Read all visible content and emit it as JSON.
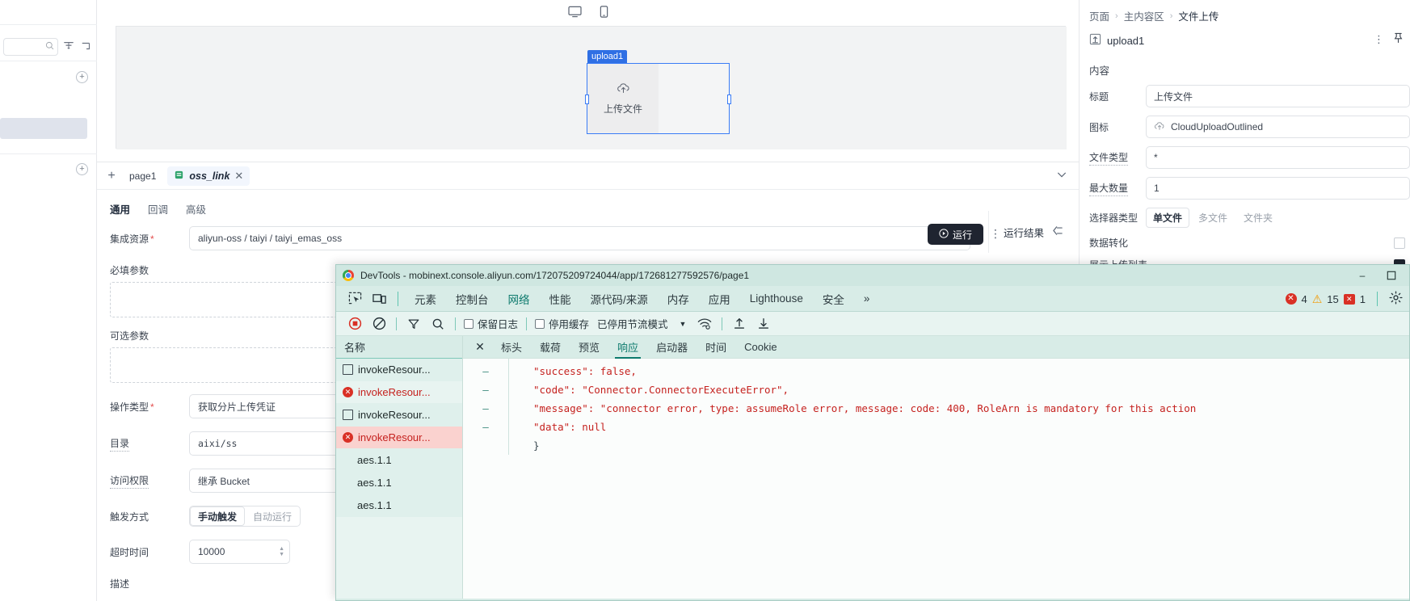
{
  "left_panel": {
    "search_placeholder": "",
    "filter_icon": "filter-icon",
    "collapse_icon": "collapse-tree-icon",
    "add_icon": "plus-circle-icon"
  },
  "canvas": {
    "device_desktop_icon": "desktop-icon",
    "device_mobile_icon": "mobile-icon",
    "widget": {
      "tag": "upload1",
      "label": "上传文件",
      "icon": "cloud-upload-icon"
    }
  },
  "mid_panel": {
    "tabs": {
      "add_label": "+",
      "page_tab": "page1",
      "active_tab": "oss_link",
      "close_label": "✕",
      "collapse_icon": "chevron-down-icon"
    },
    "subtabs": [
      {
        "label": "通用",
        "active": true
      },
      {
        "label": "回调",
        "active": false
      },
      {
        "label": "高级",
        "active": false
      }
    ],
    "run_button": "运行",
    "more_label": "⋮",
    "run_result_label": "运行结果",
    "run_result_collapse_icon": "collapse-left-icon",
    "fields": {
      "resource_label": "集成资源",
      "resource_value": "aliyun-oss / taiyi / taiyi_emas_oss",
      "required_params_label": "必填参数",
      "optional_params_label": "可选参数",
      "op_type_label": "操作类型",
      "op_type_value": "获取分片上传凭证",
      "dir_label": "目录",
      "dir_value": "aixi/ss",
      "acl_label": "访问权限",
      "acl_value": "继承 Bucket",
      "trigger_label": "触发方式",
      "trigger_manual": "手动触发",
      "trigger_auto": "自动运行",
      "timeout_label": "超时时间",
      "timeout_value": "10000",
      "desc_label": "描述"
    }
  },
  "right_panel": {
    "breadcrumb": [
      "页面",
      "主内容区",
      "文件上传"
    ],
    "breadcrumb_sep": "›",
    "component_name": "upload1",
    "component_icon": "upload-component-icon",
    "more_icon": "more-vertical-icon",
    "pin_icon": "pin-icon",
    "section_title": "内容",
    "props": [
      {
        "label": "标题",
        "value": "上传文件",
        "type": "text"
      },
      {
        "label": "图标",
        "value": "CloudUploadOutlined",
        "type": "icon-select",
        "icon": "cloud-upload-icon",
        "trailing_icon": "copy-icon"
      },
      {
        "label": "文件类型",
        "value": "*",
        "type": "text",
        "dotted": true
      },
      {
        "label": "最大数量",
        "value": "1",
        "type": "text",
        "dotted": true
      },
      {
        "label": "选择器类型",
        "type": "segmented",
        "options": [
          "单文件",
          "多文件",
          "文件夹"
        ],
        "selected": "单文件"
      },
      {
        "label": "数据转化",
        "type": "checkbox",
        "checked": false
      },
      {
        "label": "展示上传列表",
        "type": "checkbox",
        "checked": true
      }
    ]
  },
  "devtools": {
    "title": "DevTools - mobinext.console.aliyun.com/172075209724044/app/172681277592576/page1",
    "chrome_icon": "chrome-logo-icon",
    "window_controls": {
      "minimize": "–",
      "maximize": "▢"
    },
    "tools": [
      "inspect-element-icon",
      "device-toolbar-icon"
    ],
    "tabs": [
      {
        "label": "元素",
        "active": false
      },
      {
        "label": "控制台",
        "active": false
      },
      {
        "label": "网络",
        "active": true
      },
      {
        "label": "性能",
        "active": false
      },
      {
        "label": "源代码/来源",
        "active": false
      },
      {
        "label": "内存",
        "active": false
      },
      {
        "label": "应用",
        "active": false
      },
      {
        "label": "Lighthouse",
        "active": false
      },
      {
        "label": "安全",
        "active": false
      }
    ],
    "more_tabs_label": "»",
    "counters": {
      "errors": "4",
      "warnings": "15",
      "violations": "1"
    },
    "settings_icon": "gear-icon",
    "filterbar": {
      "record_icon": "record-stop-icon",
      "clear_icon": "clear-icon",
      "filter_icon": "filter-funnel-icon",
      "search_icon": "search-icon",
      "preserve_log": "保留日志",
      "disable_cache": "停用缓存",
      "throttling": "已停用节流模式",
      "throttling_caret": "▼",
      "wifi_icon": "network-conditions-icon",
      "import_icon": "import-har-icon",
      "export_icon": "export-har-icon"
    },
    "netlist": {
      "header": "名称",
      "rows": [
        {
          "name": "invokeResour...",
          "status": "ok",
          "selected": false
        },
        {
          "name": "invokeResour...",
          "status": "error",
          "selected": false
        },
        {
          "name": "invokeResour...",
          "status": "ok",
          "selected": false
        },
        {
          "name": "invokeResour...",
          "status": "error",
          "selected": true
        },
        {
          "name": "aes.1.1",
          "status": "plain",
          "selected": false
        },
        {
          "name": "aes.1.1",
          "status": "plain",
          "selected": false
        },
        {
          "name": "aes.1.1",
          "status": "plain",
          "selected": false
        }
      ]
    },
    "detail": {
      "close_label": "✕",
      "tabs": [
        {
          "label": "标头",
          "active": false
        },
        {
          "label": "载荷",
          "active": false
        },
        {
          "label": "预览",
          "active": false
        },
        {
          "label": "响应",
          "active": true
        },
        {
          "label": "启动器",
          "active": false
        },
        {
          "label": "时间",
          "active": false
        },
        {
          "label": "Cookie",
          "active": false
        }
      ],
      "gutter": [
        "–",
        "–",
        "–",
        "–",
        ""
      ],
      "response_lines": [
        "  \"success\": false,",
        "  \"code\": \"Connector.ConnectorExecuteError\",",
        "  \"message\": \"connector error, type: assumeRole error, message: code: 400, RoleArn is mandatory for this action",
        "  \"data\": null",
        "}"
      ]
    }
  },
  "colors": {
    "accent_blue": "#2f6fe4",
    "devtools_bg": "#d8ece7",
    "devtools_accent": "#0d7a6d",
    "error_red": "#c5221f",
    "warn_orange": "#f29900"
  }
}
